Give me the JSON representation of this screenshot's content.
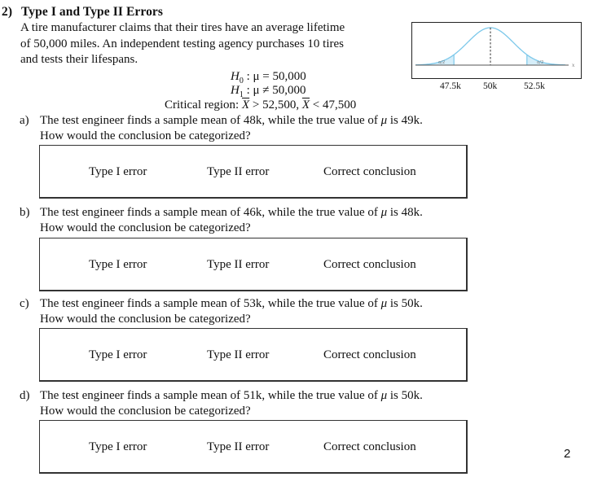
{
  "problem": {
    "number": "2)",
    "title": "Type I and Type II Errors",
    "intro_lines": [
      "A tire manufacturer claims that their tires have an average lifetime",
      "of 50,000 miles. An independent testing agency purchases 10 tires",
      "and tests their lifespans."
    ],
    "h0": {
      "symbol": "H",
      "sub": "0",
      "relation": ": μ = 50,000"
    },
    "h1": {
      "symbol": "H",
      "sub": "1",
      "relation": ": μ ≠ 50,000"
    },
    "critical_region": {
      "label": "Critical region: ",
      "x": "X",
      "part1": " > 52,500, ",
      "part2": " < 47,500"
    }
  },
  "graph": {
    "description": "normal-distribution-curve",
    "tail_label": "α/2",
    "axis_label": "x",
    "tick_labels": [
      "47.5k",
      "50k",
      "52.5k"
    ],
    "curve_color": "#7cc8ea",
    "tail_fill": "#d6eef9"
  },
  "questions": [
    {
      "letter": "a)",
      "line1_pre": "The test engineer finds a sample mean of 48k, while the true value of ",
      "mu": "μ",
      "line1_post": " is 49k.",
      "line2": "How would the conclusion be categorized?",
      "options": [
        "Type I error",
        "Type II error",
        "Correct conclusion"
      ]
    },
    {
      "letter": "b)",
      "line1_pre": "The test engineer finds a sample mean of 46k, while the true value of ",
      "mu": "μ",
      "line1_post": " is 48k.",
      "line2": "How would the conclusion be categorized?",
      "options": [
        "Type I error",
        "Type II error",
        "Correct conclusion"
      ]
    },
    {
      "letter": "c)",
      "line1_pre": "The test engineer finds a sample mean of 53k, while the true value of ",
      "mu": "μ",
      "line1_post": " is 50k.",
      "line2": "How would the conclusion be categorized?",
      "options": [
        "Type I error",
        "Type II error",
        "Correct conclusion"
      ]
    },
    {
      "letter": "d)",
      "line1_pre": "The test engineer finds a sample mean of 51k, while the true value of ",
      "mu": "μ",
      "line1_post": " is 50k.",
      "line2": "How would the conclusion be categorized?",
      "options": [
        "Type I error",
        "Type II error",
        "Correct conclusion"
      ]
    }
  ],
  "page_number": "2"
}
